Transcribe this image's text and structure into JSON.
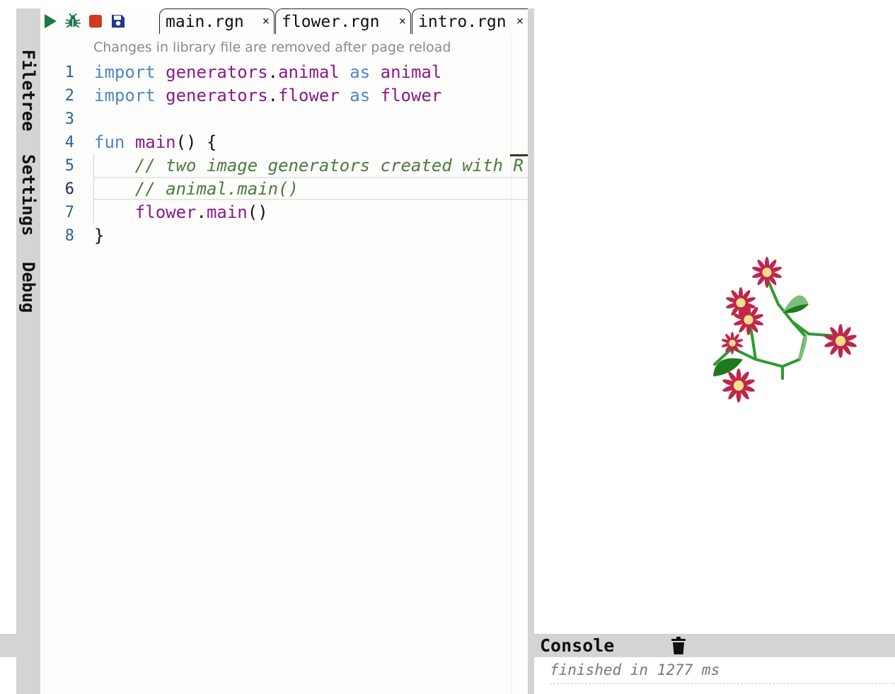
{
  "toolbar": {
    "run": "run-icon",
    "debug": "bug-icon",
    "stop": "stop-icon",
    "save": "save-icon"
  },
  "tabs": [
    {
      "label": "main.rgn",
      "close": "×"
    },
    {
      "label": "flower.rgn",
      "close": "×"
    },
    {
      "label": "intro.rgn",
      "close": "×",
      "active": true
    }
  ],
  "side_tabs": [
    "Filetree",
    "Settings",
    "Debug"
  ],
  "editor": {
    "notice": "Changes in library file are removed after page reload",
    "active_line": 6,
    "lines": [
      {
        "n": "1",
        "parts": [
          [
            "kw",
            "import"
          ],
          [
            "",
            "",
            " "
          ],
          [
            "id",
            "generators"
          ],
          [
            "",
            "."
          ],
          [
            "id",
            "animal"
          ],
          [
            "",
            " "
          ],
          [
            "kw",
            "as"
          ],
          [
            "",
            " "
          ],
          [
            "id",
            "animal"
          ]
        ]
      },
      {
        "n": "2",
        "parts": [
          [
            "kw",
            "import"
          ],
          [
            "",
            " "
          ],
          [
            "id",
            "generators"
          ],
          [
            "",
            "."
          ],
          [
            "id",
            "flower"
          ],
          [
            "",
            " "
          ],
          [
            "kw",
            "as"
          ],
          [
            "",
            " "
          ],
          [
            "id",
            "flower"
          ]
        ]
      },
      {
        "n": "3",
        "parts": []
      },
      {
        "n": "4",
        "parts": [
          [
            "kw",
            "fun"
          ],
          [
            "",
            " "
          ],
          [
            "id",
            "main"
          ],
          [
            "",
            "() {"
          ]
        ]
      },
      {
        "n": "5",
        "parts": [
          [
            "",
            "    "
          ],
          [
            "cm",
            "// two image generators created with R"
          ]
        ]
      },
      {
        "n": "6",
        "parts": [
          [
            "",
            "    "
          ],
          [
            "cm",
            "// animal.main()"
          ]
        ]
      },
      {
        "n": "7",
        "parts": [
          [
            "",
            "    "
          ],
          [
            "id",
            "flower"
          ],
          [
            "",
            "."
          ],
          [
            "id",
            "main"
          ],
          [
            "",
            "()"
          ]
        ]
      },
      {
        "n": "8",
        "parts": [
          [
            "",
            "}"
          ]
        ]
      }
    ]
  },
  "console": {
    "title": "Console",
    "clear_icon": "trash-icon",
    "output": "finished in 1277 ms"
  },
  "colors": {
    "panel_gray": "#d4d4d4",
    "keyword": "#4f86c6",
    "identifier": "#8a1a8a",
    "comment": "#4c7a3f",
    "line_number": "#2a6496",
    "petal": "#c0254a",
    "flower_center": "#f5e08a",
    "stem": "#2e9a2e",
    "leaf": "#1f7a1f"
  }
}
